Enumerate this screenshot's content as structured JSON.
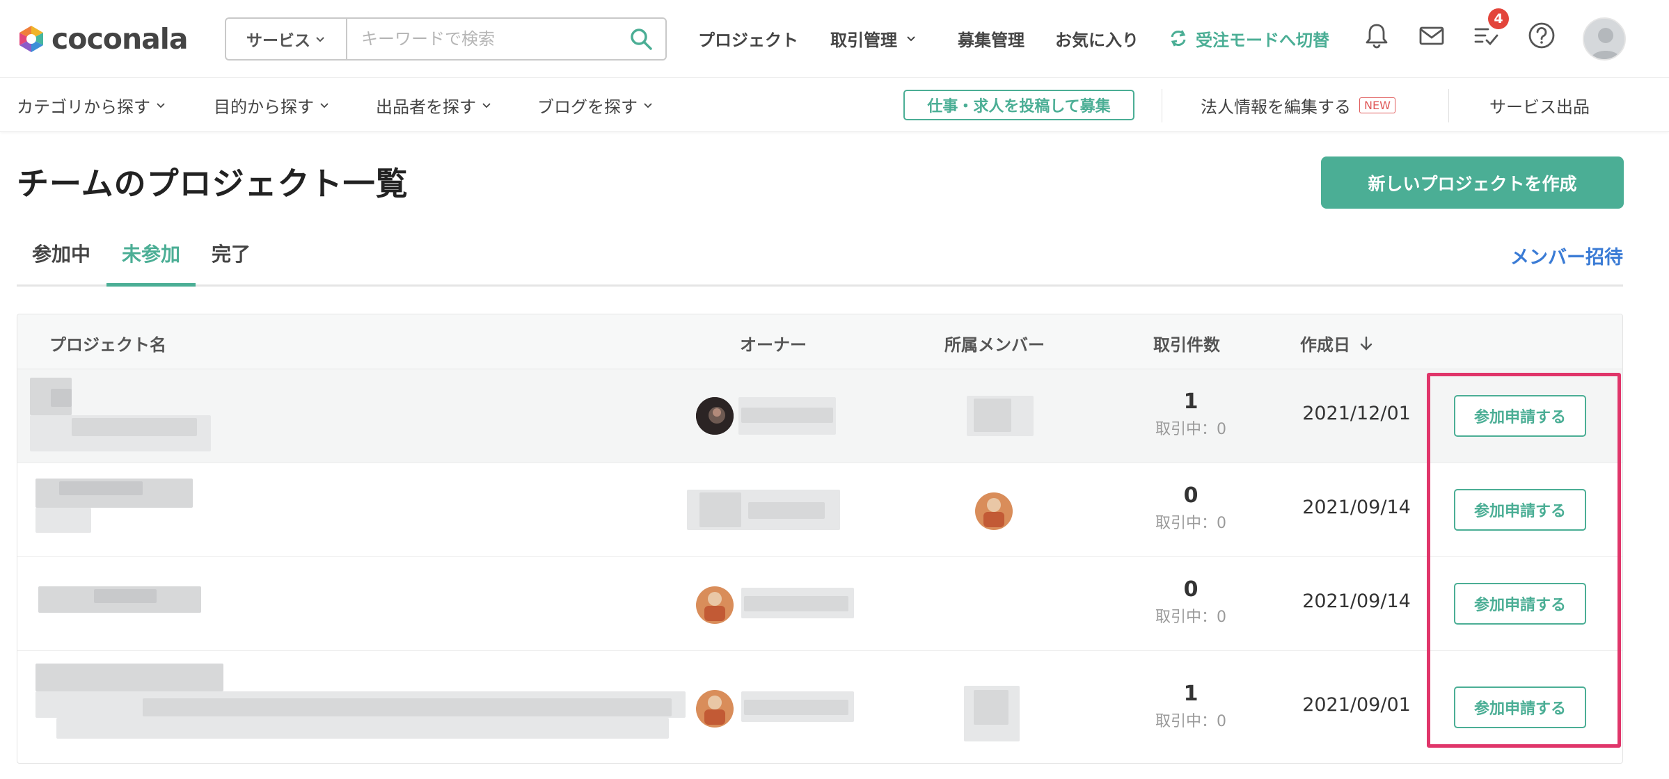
{
  "header": {
    "logo_text": "coconala",
    "search": {
      "category": "サービス",
      "placeholder": "キーワードで検索"
    },
    "nav": {
      "project": "プロジェクト",
      "transactions": "取引管理",
      "recruit": "募集管理",
      "favorites": "お気に入り",
      "mode_switch": "受注モードへ切替"
    },
    "todo_badge": "4"
  },
  "subnav": {
    "category": "カテゴリから探す",
    "purpose": "目的から探す",
    "sellers": "出品者を探す",
    "blog": "ブログを探す",
    "post_job": "仕事・求人を投稿して募集",
    "corp_edit": "法人情報を編集する",
    "new_badge": "NEW",
    "service_listing": "サービス出品"
  },
  "page": {
    "title": "チームのプロジェクト一覧",
    "create_button": "新しいプロジェクトを作成",
    "tabs": [
      "参加中",
      "未参加",
      "完了"
    ],
    "invite_link": "メンバー招待"
  },
  "table": {
    "headers": {
      "name": "プロジェクト名",
      "owner": "オーナー",
      "members": "所属メンバー",
      "count": "取引件数",
      "date": "作成日"
    },
    "rows": [
      {
        "count": "1",
        "active": "取引中：0",
        "date": "2021/12/01",
        "action": "参加申請する"
      },
      {
        "count": "0",
        "active": "取引中：0",
        "date": "2021/09/14",
        "action": "参加申請する"
      },
      {
        "count": "0",
        "active": "取引中：0",
        "date": "2021/09/14",
        "action": "参加申請する"
      },
      {
        "count": "1",
        "active": "取引中：0",
        "date": "2021/09/01",
        "action": "参加申請する"
      }
    ]
  },
  "colors": {
    "accent": "#4bae95",
    "link": "#3a7bd5",
    "badge": "#e3453b",
    "highlight": "#e0356a"
  }
}
